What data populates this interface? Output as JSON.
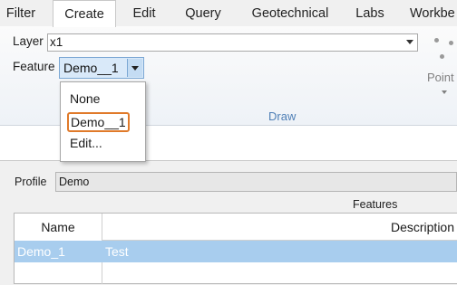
{
  "tabs": [
    "Filter",
    "Create",
    "Edit",
    "Query",
    "Geotechnical",
    "Labs",
    "Workbe"
  ],
  "ribbon": {
    "layer_label": "Layer",
    "layer_value": "x1",
    "feature_label": "Feature",
    "feature_value": "Demo__1",
    "group_label": "Draw",
    "point_label": "Point"
  },
  "dropdown": {
    "items": [
      "None",
      "Demo__1",
      "Edit..."
    ],
    "highlighted_index": 1
  },
  "profile": {
    "label": "Profile",
    "value": "Demo"
  },
  "features": {
    "section_label": "Features",
    "columns": [
      "Name",
      "Description"
    ],
    "rows": [
      {
        "name": "Demo_1",
        "description": "Test"
      }
    ]
  },
  "colors": {
    "accent": "#4f7fb6",
    "selection": "#a8cdee",
    "highlight_border": "#e07a2a"
  }
}
